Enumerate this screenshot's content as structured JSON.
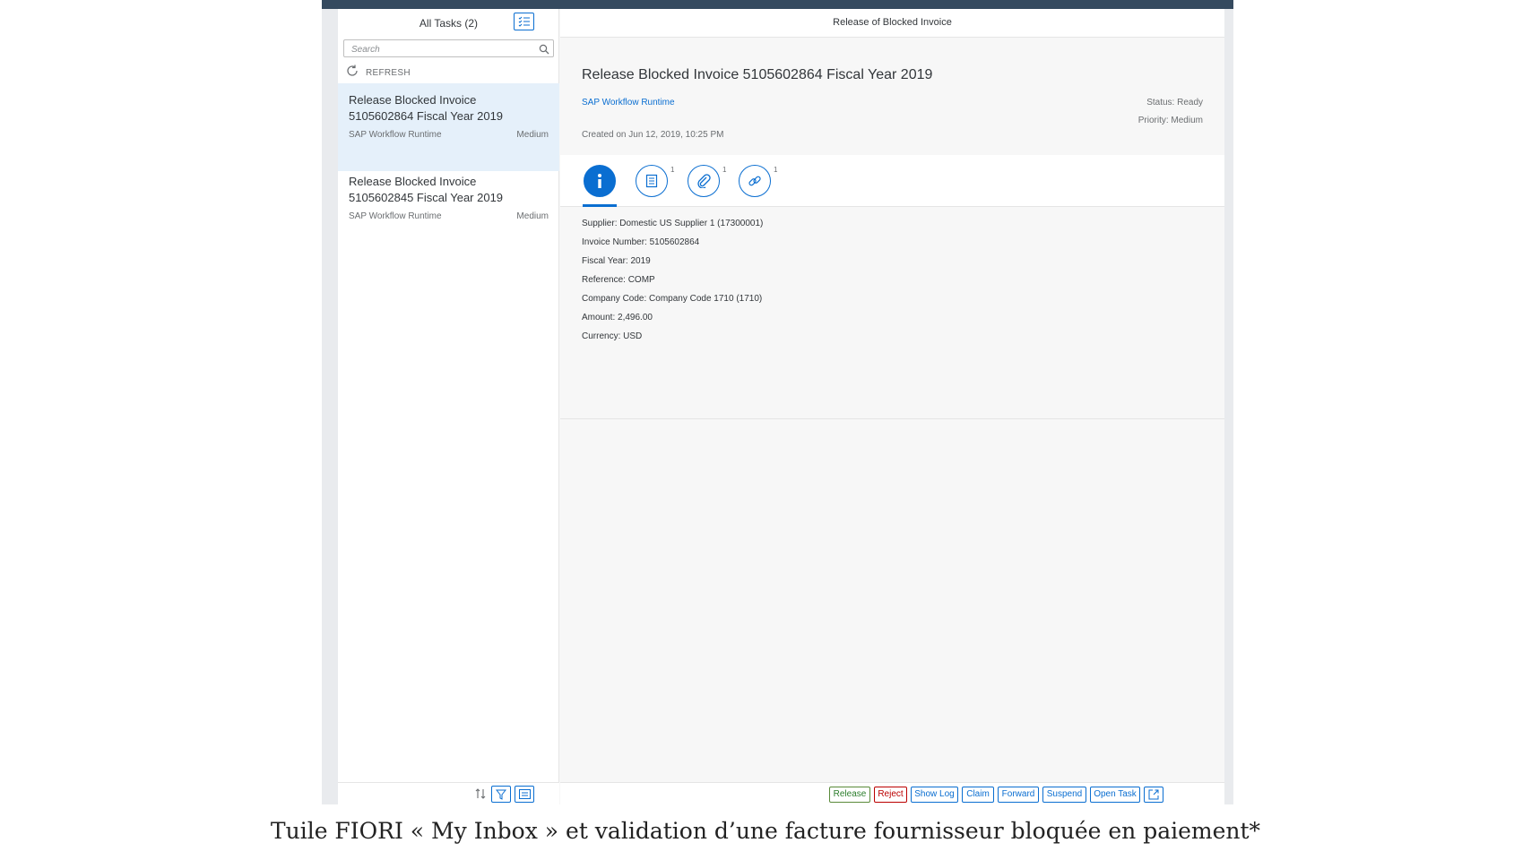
{
  "master": {
    "title": "All Tasks (2)",
    "search_placeholder": "Search",
    "refresh_label": "REFRESH",
    "tasks": [
      {
        "title": "Release Blocked Invoice 5105602864 Fiscal Year 2019",
        "source": "SAP Workflow Runtime",
        "priority": "Medium"
      },
      {
        "title": "Release Blocked Invoice 5105602845 Fiscal Year 2019",
        "source": "SAP Workflow Runtime",
        "priority": "Medium"
      }
    ]
  },
  "detail": {
    "bar_title": "Release of Blocked Invoice",
    "title": "Release Blocked Invoice 5105602864 Fiscal Year 2019",
    "source_link": "SAP Workflow Runtime",
    "created": "Created on Jun 12, 2019, 10:25 PM",
    "status": "Status: Ready",
    "priority": "Priority: Medium",
    "tabs": [
      {
        "icon": "info-icon",
        "count": ""
      },
      {
        "icon": "notes-icon",
        "count": "1"
      },
      {
        "icon": "attachment-icon",
        "count": "1"
      },
      {
        "icon": "link-icon",
        "count": "1"
      }
    ],
    "info_rows": [
      "Supplier: Domestic US Supplier 1 (17300001)",
      "Invoice Number: 5105602864",
      "Fiscal Year: 2019",
      "Reference: COMP",
      "Company Code: Company Code 1710 (1710)",
      "Amount: 2,496.00",
      "Currency: USD"
    ]
  },
  "actions": {
    "release": "Release",
    "reject": "Reject",
    "show_log": "Show Log",
    "claim": "Claim",
    "forward": "Forward",
    "suspend": "Suspend",
    "open_task": "Open Task"
  },
  "caption": "Tuile FIORI « My Inbox » et validation d’une facture fournisseur bloquée en paiement*",
  "colors": {
    "brand_blue": "#0a6ed1",
    "shell": "#354a5f",
    "selected_row": "#e5f0fa",
    "reject_red": "#bb0000",
    "release_green": "#2b7d2b"
  }
}
